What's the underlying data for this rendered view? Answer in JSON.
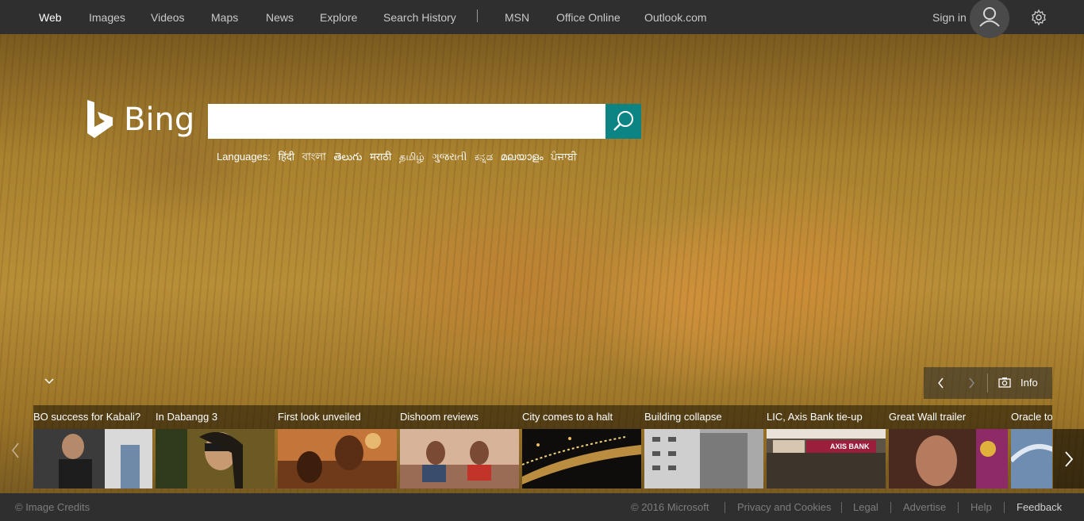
{
  "nav": {
    "links": [
      "Web",
      "Images",
      "Videos",
      "Maps",
      "News",
      "Explore",
      "Search History"
    ],
    "secondary_links": [
      "MSN",
      "Office Online",
      "Outlook.com"
    ],
    "signin_label": "Sign in",
    "active": "Web"
  },
  "brand": {
    "name": "Bing",
    "accent": "#0c8484"
  },
  "search": {
    "value": "",
    "placeholder": ""
  },
  "languages": {
    "label": "Languages:",
    "items": [
      "हिंदी",
      "বাংলা",
      "తెలుగు",
      "मराठी",
      "தமிழ்",
      "ગુજરાતી",
      "ಕನ್ನಡ",
      "മലയാളം",
      "ਪੰਜਾਬੀ"
    ]
  },
  "info_panel": {
    "label": "Info"
  },
  "carousel": {
    "items": [
      {
        "label": "BO success for Kabali?"
      },
      {
        "label": "In Dabangg 3"
      },
      {
        "label": "First look unveiled"
      },
      {
        "label": "Dishoom reviews"
      },
      {
        "label": "City comes to a halt"
      },
      {
        "label": "Building collapse"
      },
      {
        "label": "LIC, Axis Bank tie-up"
      },
      {
        "label": "Great Wall trailer"
      },
      {
        "label": "Oracle to"
      }
    ],
    "thumb_sign": "AXIS BANK"
  },
  "footer": {
    "image_credits": "© Image Credits",
    "copyright": "© 2016 Microsoft",
    "links": [
      "Privacy and Cookies",
      "Legal",
      "Advertise",
      "Help",
      "Feedback"
    ]
  }
}
